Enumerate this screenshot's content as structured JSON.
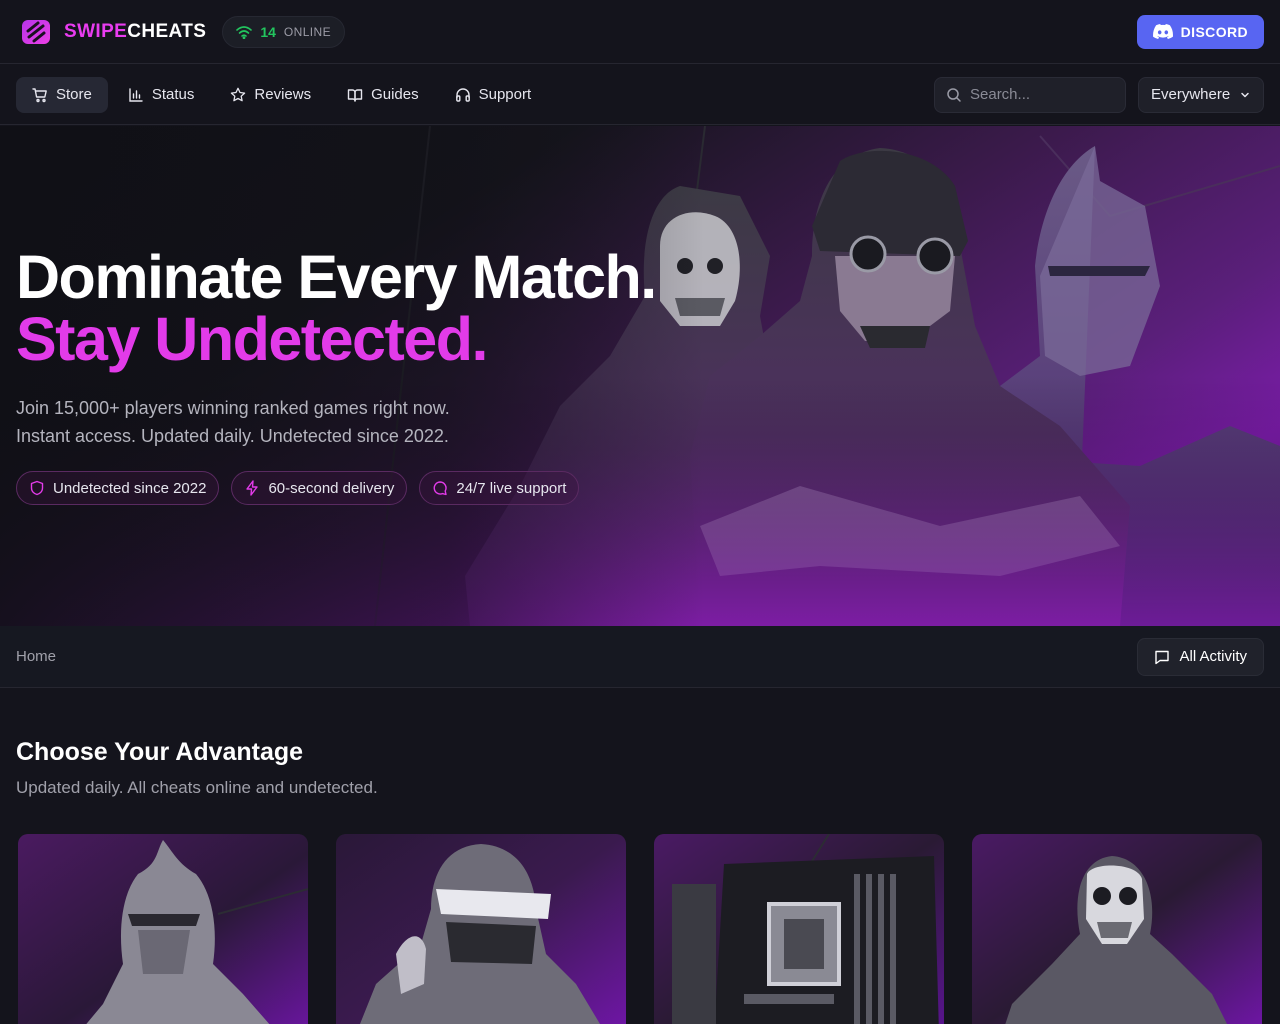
{
  "brand": {
    "part1": "SWIPE",
    "part2": "CHEATS",
    "accent_color": "#e93cf0",
    "logo_icon": "stacked-bars-logo-icon"
  },
  "online": {
    "count": "14",
    "label": "ONLINE",
    "icon": "wifi-icon",
    "color": "#22c55e"
  },
  "discord": {
    "label": "DISCORD",
    "icon": "discord-icon",
    "color": "#5865f2"
  },
  "nav": {
    "items": [
      {
        "label": "Store",
        "icon": "cart-icon",
        "active": true
      },
      {
        "label": "Status",
        "icon": "bar-chart-icon",
        "active": false
      },
      {
        "label": "Reviews",
        "icon": "star-icon",
        "active": false
      },
      {
        "label": "Guides",
        "icon": "book-icon",
        "active": false
      },
      {
        "label": "Support",
        "icon": "headphones-icon",
        "active": false
      }
    ],
    "search_placeholder": "Search...",
    "scope_value": "Everywhere"
  },
  "hero": {
    "title_line1": "Dominate Every Match.",
    "title_line2": "Stay Undetected.",
    "subtitle_line1": "Join 15,000+ players winning ranked games right now.",
    "subtitle_line2": "Instant access. Updated daily. Undetected since 2022.",
    "features": [
      {
        "label": "Undetected since 2022",
        "icon": "shield-icon"
      },
      {
        "label": "60-second delivery",
        "icon": "lightning-icon"
      },
      {
        "label": "24/7 live support",
        "icon": "chat-bubble-icon"
      }
    ]
  },
  "breadcrumb": {
    "home": "Home"
  },
  "activity": {
    "label": "All Activity",
    "icon": "chat-square-icon"
  },
  "section": {
    "title": "Choose Your Advantage",
    "subtitle": "Updated daily. All cheats online and undetected."
  },
  "cards": [
    {
      "image": "knight-character-image"
    },
    {
      "image": "soldier-visor-character-image"
    },
    {
      "image": "motherboard-image"
    },
    {
      "image": "skull-mask-soldier-image"
    }
  ]
}
